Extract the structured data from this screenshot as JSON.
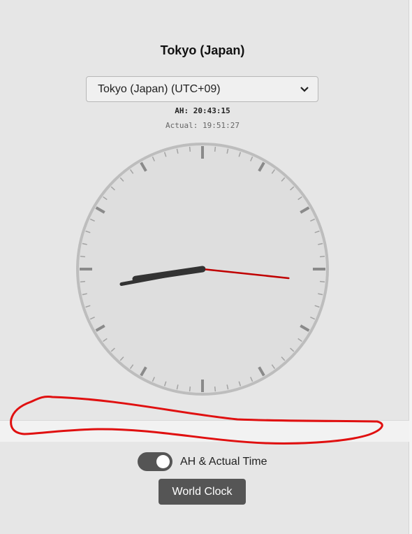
{
  "city_title": "Tokyo (Japan)",
  "timezone_select": {
    "selected": "Tokyo (Japan) (UTC+09)"
  },
  "times": {
    "ah": "AH: 20:43:15",
    "actual": "Actual: 19:51:27"
  },
  "clock": {
    "hour_hand_hours": 8.72,
    "minute_hand_minutes": 43.25,
    "second_hand_seconds": 16
  },
  "toggle": {
    "label": "AH & Actual Time",
    "on": true
  },
  "world_clock_button": "World Clock",
  "colors": {
    "background": "#e6e6e6",
    "clock_face": "#dedede",
    "hands": "#333333",
    "second_hand": "#c00000",
    "annotation": "#e01010",
    "button": "#555555"
  }
}
